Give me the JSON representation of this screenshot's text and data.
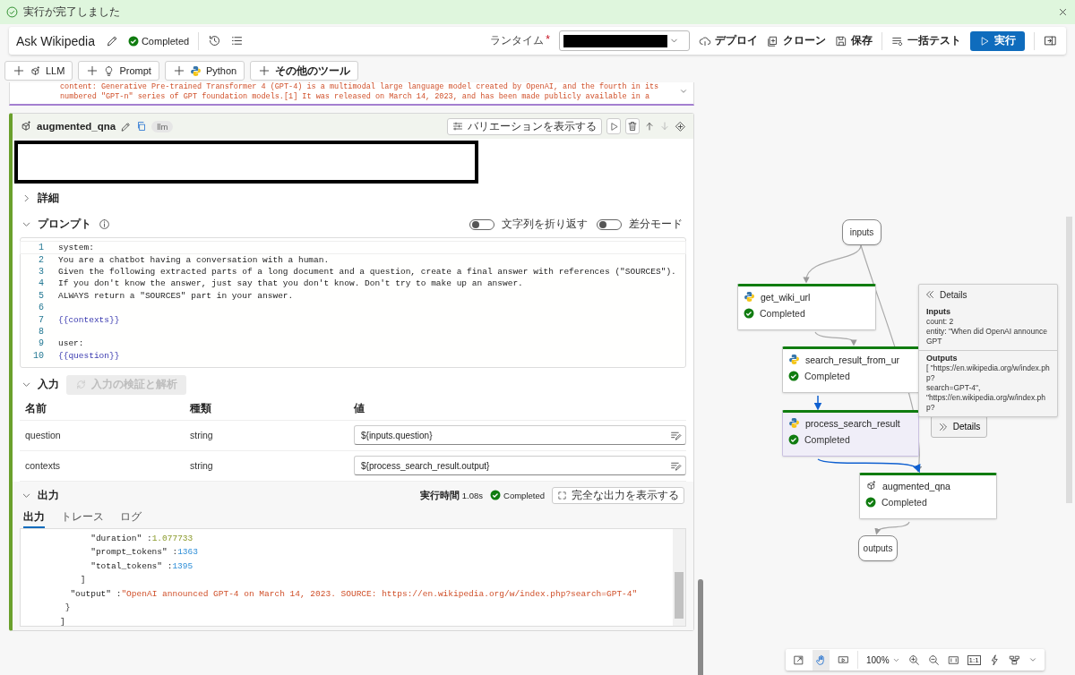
{
  "banner": {
    "message": "実行が完了しました"
  },
  "header": {
    "title": "Ask Wikipedia",
    "status": "Completed",
    "runtime_label": "ランタイム",
    "required_mark": "*",
    "actions": [
      {
        "label": "デプロイ",
        "kind": "deploy"
      },
      {
        "label": "クローン",
        "kind": "clone"
      },
      {
        "label": "保存",
        "kind": "save"
      },
      {
        "label": "一括テスト",
        "kind": "batch"
      }
    ],
    "run_button": "実行"
  },
  "tool_buttons": [
    {
      "label": "LLM",
      "kind": "llm"
    },
    {
      "label": "Prompt",
      "kind": "prompt"
    },
    {
      "label": "Python",
      "kind": "python"
    },
    {
      "label": "その他のツール",
      "kind": "more"
    }
  ],
  "previous_output": [
    "content: Generative Pre-trained Transformer 4 (GPT-4) is a multimodal large language model created by OpenAI, and the fourth in its",
    "numbered \"GPT-n\" series of GPT foundation models.[1] It was released on March 14, 2023, and has been made publicly available in a"
  ],
  "node": {
    "name": "augmented_qna",
    "type_badge": "llm",
    "variation_button": "バリエーションを表示する",
    "details": {
      "label": "詳細",
      "expanded": false
    },
    "prompt": {
      "label": "プロンプト",
      "expanded": true,
      "toggles": [
        {
          "label": "文字列を折り返す",
          "on": false
        },
        {
          "label": "差分モード",
          "on": false
        }
      ],
      "lines": [
        {
          "number": "1",
          "text": "system:",
          "kind": "text"
        },
        {
          "number": "2",
          "text": "You are a chatbot having a conversation with a human.",
          "kind": "text"
        },
        {
          "number": "3",
          "text": "Given the following extracted parts of a long document and a question, create a final answer with references (\"SOURCES\").",
          "kind": "text"
        },
        {
          "number": "4",
          "text": "If you don't know the answer, just say that you don't know. Don't try to make up an answer.",
          "kind": "text"
        },
        {
          "number": "5",
          "text": "ALWAYS return a \"SOURCES\" part in your answer.",
          "kind": "text"
        },
        {
          "number": "6",
          "kind": "text"
        },
        {
          "number": "7",
          "text": "{{contexts}}",
          "kind": "variable"
        },
        {
          "number": "8",
          "kind": "text"
        },
        {
          "number": "9",
          "text": "user:",
          "kind": "text"
        },
        {
          "number": "10",
          "text": "{{question}}",
          "kind": "variable"
        }
      ]
    },
    "inputs": {
      "label": "入力",
      "expanded": true,
      "validate_button": "入力の検証と解析",
      "validate_disabled": true,
      "columns": [
        "名前",
        "種類",
        "値"
      ],
      "rows": [
        {
          "name": "question",
          "type": "string",
          "value": "${inputs.question}"
        },
        {
          "name": "contexts",
          "type": "string",
          "value": "${process_search_result.output}"
        }
      ]
    },
    "outputs": {
      "label": "出力",
      "expanded": true,
      "duration_label": "実行時間",
      "duration": "1.08s",
      "status": "Completed",
      "full_output_button": "完全な出力を表示する",
      "tabs": [
        {
          "label": "出力",
          "selected": true
        },
        {
          "label": "トレース",
          "selected": false
        },
        {
          "label": "ログ",
          "selected": false
        }
      ],
      "lines": [
        {
          "key": "      \"duration\" :",
          "value": "1.077733",
          "kind": "float"
        },
        {
          "key": "      \"prompt_tokens\" :",
          "value": "1363",
          "kind": "int"
        },
        {
          "key": "      \"total_tokens\" :",
          "value": "1395",
          "kind": "int"
        },
        {
          "key": "    ]",
          "kind": "punct"
        },
        {
          "key": "  \"output\" :",
          "value": "\"OpenAI announced GPT-4 on March 14, 2023. SOURCE: https://en.wikipedia.org/w/index.php?search=GPT-4\"",
          "kind": "string"
        },
        {
          "key": " }",
          "kind": "punct"
        },
        {
          "key": "]",
          "kind": "punct"
        }
      ]
    }
  },
  "graph": {
    "nodes": [
      {
        "label": "inputs",
        "kind": "io"
      },
      {
        "label": "get_wiki_url",
        "kind": "python",
        "status": "Completed",
        "selected": false
      },
      {
        "label": "search_result_from_ur",
        "kind": "python",
        "status": "Completed",
        "selected": false
      },
      {
        "label": "process_search_result",
        "kind": "python",
        "status": "Completed",
        "selected": true
      },
      {
        "label": "augmented_qna",
        "kind": "llm",
        "status": "Completed",
        "selected": false
      },
      {
        "label": "outputs",
        "kind": "io"
      }
    ],
    "popover": {
      "title": "Details",
      "inputs_label": "Inputs",
      "inputs": [
        "count: 2",
        "entity: \"When did OpenAI announce GPT"
      ],
      "outputs_label": "Outputs",
      "outputs": [
        "[ \"https://en.wikipedia.org/w/index.php?",
        "search=GPT-4\",",
        "\"https://en.wikipedia.org/w/index.php?"
      ]
    },
    "details_button": "Details",
    "zoom_level": "100%",
    "actual_size": "1:1"
  }
}
